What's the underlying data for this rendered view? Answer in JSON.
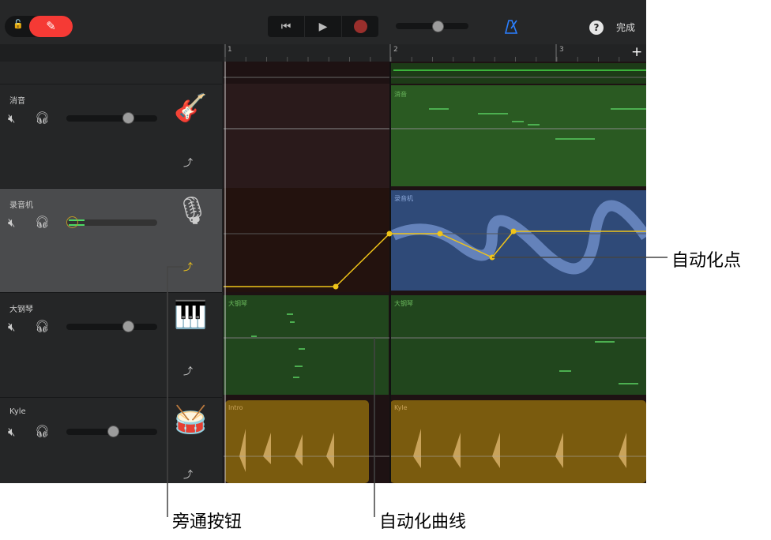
{
  "toolbar": {
    "pencil": "✎",
    "lock": "🔓",
    "prev": "⏮",
    "play": "▶",
    "help": "?",
    "done": "完成"
  },
  "ruler": {
    "bars": [
      "1",
      "2",
      "3"
    ],
    "add": "+"
  },
  "tracks": [
    {
      "name": "消音",
      "volume": 0.65,
      "instrument": "bass-guitar"
    },
    {
      "name": "录音机",
      "volume": 0.03,
      "instrument": "microphone",
      "selected": true
    },
    {
      "name": "大钢琴",
      "volume": 0.65,
      "instrument": "grand-piano"
    },
    {
      "name": "Kyle",
      "volume": 0.5,
      "instrument": "drums"
    }
  ],
  "regions": {
    "bass": "消音",
    "recorder": "录音机",
    "piano1": "大钢琴",
    "piano2": "大钢琴",
    "drums1": "Intro",
    "drums2": "Kyle"
  },
  "colors": {
    "accent": "#f53a35",
    "automation": "#f0c419",
    "green": "#2a5a22",
    "blue": "#2f4a78",
    "gold": "#7a5b0e"
  },
  "callouts": {
    "automation_point": "自动化点",
    "bypass_button": "旁通按钮",
    "automation_curve": "自动化曲线"
  }
}
